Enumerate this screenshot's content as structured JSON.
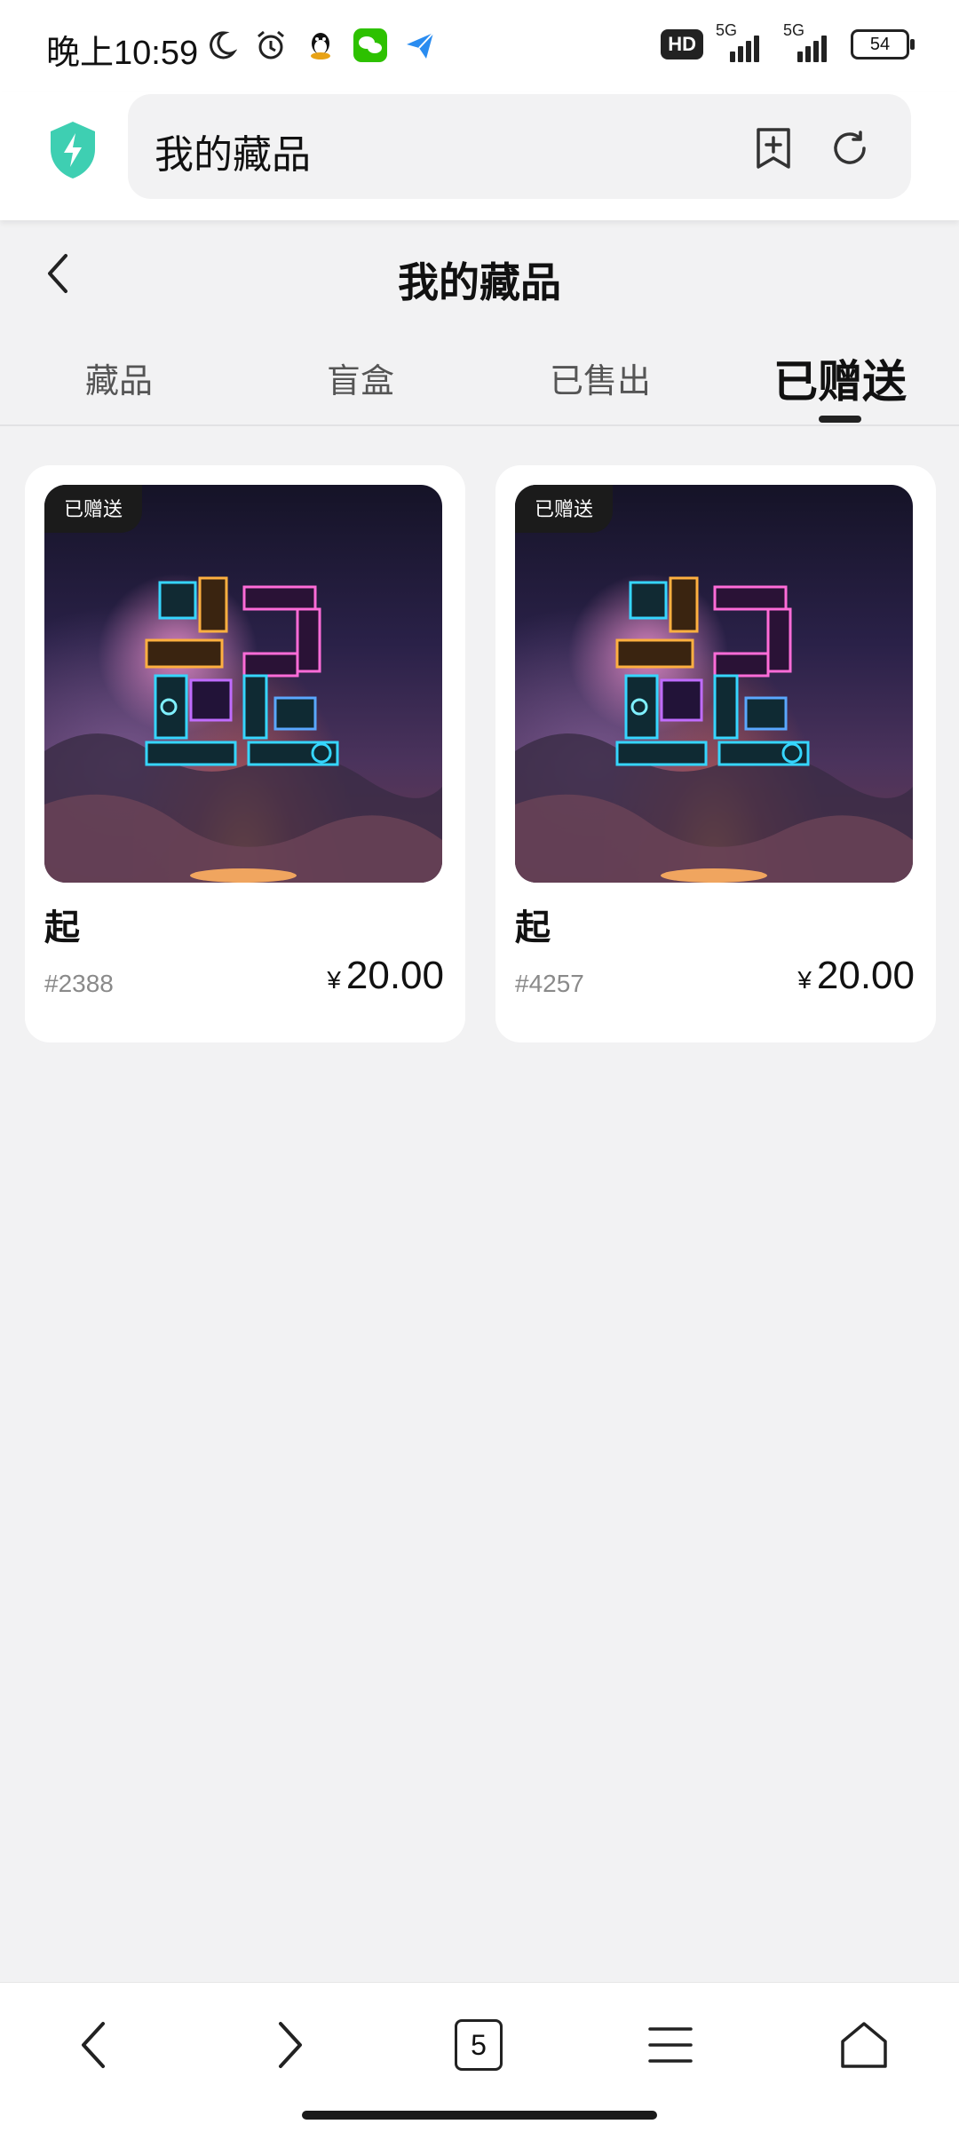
{
  "status_bar": {
    "time": "晚上10:59",
    "hd_label": "HD",
    "network_1": "5G",
    "network_2": "5G",
    "battery": "54"
  },
  "browser": {
    "url_title": "我的藏品"
  },
  "page": {
    "title": "我的藏品"
  },
  "tabs": [
    {
      "label": "藏品",
      "active": false
    },
    {
      "label": "盲盒",
      "active": false
    },
    {
      "label": "已售出",
      "active": false
    },
    {
      "label": "已赠送",
      "active": true
    }
  ],
  "items": [
    {
      "badge": "已赠送",
      "name": "起",
      "serial": "#2388",
      "currency": "¥",
      "price": "20.00"
    },
    {
      "badge": "已赠送",
      "name": "起",
      "serial": "#4257",
      "currency": "¥",
      "price": "20.00"
    }
  ],
  "bottom_nav": {
    "tab_count": "5"
  },
  "colors": {
    "background": "#f2f2f3",
    "accent": "#2ec4a6",
    "card": "#ffffff"
  }
}
